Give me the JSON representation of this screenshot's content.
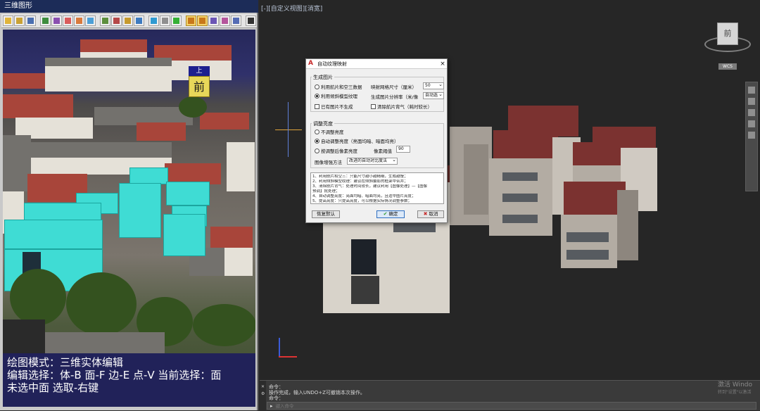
{
  "left_panel": {
    "title": "三维图形",
    "view_cube": {
      "top": "上",
      "front": "前"
    },
    "mode_lines": [
      "绘图模式：三维实体编辑",
      "编辑选择：体-B 面-F 边-E 点-V 当前选择：面",
      "未选中面 选取-右键"
    ]
  },
  "viewport": {
    "label": "[-][自定义视图][消宽]",
    "view_cube_label": "前",
    "wcs_badge": "WCS"
  },
  "dialog": {
    "title": "自动纹理映射",
    "close_symbol": "×",
    "group1": {
      "label": "生成图片",
      "opt_plane": "利用航片和空三数据",
      "opt_model": "利用倾斜模型纹理",
      "opt_skip": "已有图片不生成",
      "grid_label": "映射网格尺寸（厘米）",
      "grid_value": "50",
      "res_label": "生成图片分辨率（米/像",
      "res_value": "自动选",
      "clear_label": "清除航片背气（耗时较长）"
    },
    "group2": {
      "label": "调整亮度",
      "opt_none": "不调整亮度",
      "opt_auto": "自动调整亮度（亮面均暗、暗面均亮）",
      "opt_pixel": "按调整后像素亮度",
      "pixel_label": "像素阈值",
      "pixel_value": "90",
      "method_label": "图像增强方法",
      "method_value": "改进的自动对比度法"
    },
    "notes": [
      "1、利用航片和空三：只能尺寸越小越精细，生成越慢；",
      "2、利用倾斜模型纹理：建议在倾斜摄影的框架中合并；",
      "3、清除航片背气：处理时间较长，建议利用【图像处理】—【图像",
      "   预调】批处理；",
      "4、自动调整亮度：亮面均暗、暗面均亮，且适中图片亮度；",
      "5、提高亮度：只提高亮度，可以根据实际情况调整参数；"
    ],
    "btn_restore": "恢复默认",
    "btn_ok": "确定",
    "btn_cancel": "取消"
  },
  "command": {
    "line1": "命令：",
    "line2": "操作完成，输入UNDO+Z可撤销本次操作。",
    "line3": "命令：",
    "input_placeholder": "键入命令"
  },
  "watermark": {
    "line1": "激活 Windo",
    "line2": "转到\"设置\"以激活"
  },
  "colors": {
    "cyan_selection": "#3fdcd4",
    "mode_box_bg": "#20205c",
    "title_bar": "#1c2c58"
  }
}
